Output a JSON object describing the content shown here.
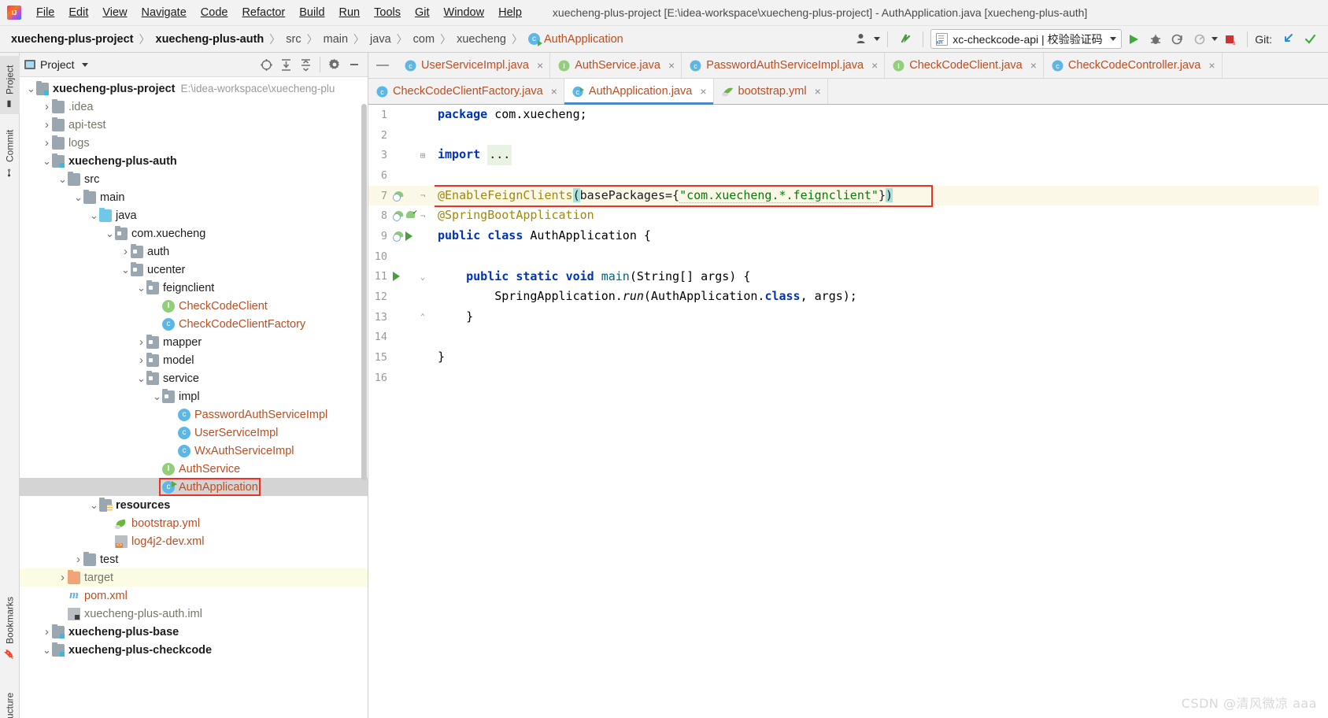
{
  "window": {
    "title": "xuecheng-plus-project [E:\\idea-workspace\\xuecheng-plus-project] - AuthApplication.java [xuecheng-plus-auth]"
  },
  "menu": {
    "items": [
      {
        "label": "File"
      },
      {
        "label": "Edit"
      },
      {
        "label": "View"
      },
      {
        "label": "Navigate"
      },
      {
        "label": "Code"
      },
      {
        "label": "Refactor"
      },
      {
        "label": "Build"
      },
      {
        "label": "Run"
      },
      {
        "label": "Tools"
      },
      {
        "label": "Git"
      },
      {
        "label": "Window"
      },
      {
        "label": "Help"
      }
    ]
  },
  "breadcrumb": {
    "items": [
      {
        "label": "xuecheng-plus-project",
        "style": "bold"
      },
      {
        "label": "xuecheng-plus-auth",
        "style": "bold"
      },
      {
        "label": "src",
        "style": "normal"
      },
      {
        "label": "main",
        "style": "normal"
      },
      {
        "label": "java",
        "style": "normal"
      },
      {
        "label": "com",
        "style": "normal"
      },
      {
        "label": "xuecheng",
        "style": "normal"
      },
      {
        "label": "AuthApplication",
        "style": "class"
      }
    ],
    "separator": "〉"
  },
  "toolbar": {
    "run_config": "xc-checkcode-api | 校验验证码",
    "git_label": "Git:",
    "icons": [
      "user-settings-icon",
      "search-everywhere-icon",
      "run-icon",
      "debug-icon",
      "run-with-coverage-icon",
      "profiler-icon",
      "stop-icon",
      "update-project-icon",
      "commit-icon"
    ]
  },
  "left_strip": {
    "tabs": [
      {
        "label": "Project",
        "icon": "project-icon",
        "selected": true
      },
      {
        "label": "Commit",
        "icon": "commit-icon",
        "selected": false
      },
      {
        "label": "Bookmarks",
        "icon": "bookmark-icon",
        "selected": false
      },
      {
        "label": "ucture",
        "icon": "structure-icon",
        "selected": false
      }
    ]
  },
  "project_panel": {
    "title": "Project",
    "tools": [
      "locate-icon",
      "expand-all-icon",
      "collapse-all-icon",
      "settings-icon",
      "hide-icon"
    ],
    "tree": [
      {
        "depth": 0,
        "arrow": "v",
        "icon": "module",
        "label": "xuecheng-plus-project",
        "style": "bold",
        "hint": "E:\\idea-workspace\\xuecheng-plu"
      },
      {
        "depth": 1,
        "arrow": ">",
        "icon": "folder",
        "label": ".idea",
        "style": "gray",
        "hint": ""
      },
      {
        "depth": 1,
        "arrow": ">",
        "icon": "folder",
        "label": "api-test",
        "style": "gray",
        "hint": ""
      },
      {
        "depth": 1,
        "arrow": ">",
        "icon": "folder",
        "label": "logs",
        "style": "gray",
        "hint": ""
      },
      {
        "depth": 1,
        "arrow": "v",
        "icon": "module",
        "label": "xuecheng-plus-auth",
        "style": "bold",
        "hint": ""
      },
      {
        "depth": 2,
        "arrow": "v",
        "icon": "folder",
        "label": "src",
        "style": "normal",
        "hint": ""
      },
      {
        "depth": 3,
        "arrow": "v",
        "icon": "folder",
        "label": "main",
        "style": "normal",
        "hint": ""
      },
      {
        "depth": 4,
        "arrow": "v",
        "icon": "folder-blue",
        "label": "java",
        "style": "normal",
        "hint": ""
      },
      {
        "depth": 5,
        "arrow": "v",
        "icon": "pkg",
        "label": "com.xuecheng",
        "style": "normal",
        "hint": ""
      },
      {
        "depth": 6,
        "arrow": ">",
        "icon": "pkg",
        "label": "auth",
        "style": "normal",
        "hint": ""
      },
      {
        "depth": 6,
        "arrow": "v",
        "icon": "pkg",
        "label": "ucenter",
        "style": "normal",
        "hint": ""
      },
      {
        "depth": 7,
        "arrow": "v",
        "icon": "pkg",
        "label": "feignclient",
        "style": "normal",
        "hint": ""
      },
      {
        "depth": 8,
        "arrow": "",
        "icon": "iface",
        "label": "CheckCodeClient",
        "style": "orange",
        "hint": ""
      },
      {
        "depth": 8,
        "arrow": "",
        "icon": "class",
        "label": "CheckCodeClientFactory",
        "style": "orange",
        "hint": ""
      },
      {
        "depth": 7,
        "arrow": ">",
        "icon": "pkg",
        "label": "mapper",
        "style": "normal",
        "hint": ""
      },
      {
        "depth": 7,
        "arrow": ">",
        "icon": "pkg",
        "label": "model",
        "style": "normal",
        "hint": ""
      },
      {
        "depth": 7,
        "arrow": "v",
        "icon": "pkg",
        "label": "service",
        "style": "normal",
        "hint": ""
      },
      {
        "depth": 8,
        "arrow": "v",
        "icon": "pkg",
        "label": "impl",
        "style": "normal",
        "hint": ""
      },
      {
        "depth": 9,
        "arrow": "",
        "icon": "class",
        "label": "PasswordAuthServiceImpl",
        "style": "orange",
        "hint": ""
      },
      {
        "depth": 9,
        "arrow": "",
        "icon": "class",
        "label": "UserServiceImpl",
        "style": "orange",
        "hint": ""
      },
      {
        "depth": 9,
        "arrow": "",
        "icon": "class",
        "label": "WxAuthServiceImpl",
        "style": "orange",
        "hint": ""
      },
      {
        "depth": 8,
        "arrow": "",
        "icon": "iface",
        "label": "AuthService",
        "style": "orange",
        "hint": ""
      },
      {
        "depth": 8,
        "arrow": "",
        "icon": "springclass",
        "label": "AuthApplication",
        "style": "orange",
        "hint": "",
        "selected": true,
        "boxed": true
      },
      {
        "depth": 4,
        "arrow": "v",
        "icon": "res",
        "label": "resources",
        "style": "bold",
        "hint": ""
      },
      {
        "depth": 5,
        "arrow": "",
        "icon": "yml",
        "label": "bootstrap.yml",
        "style": "orange",
        "hint": ""
      },
      {
        "depth": 5,
        "arrow": "",
        "icon": "xml",
        "label": "log4j2-dev.xml",
        "style": "orange",
        "hint": ""
      },
      {
        "depth": 3,
        "arrow": ">",
        "icon": "folder",
        "label": "test",
        "style": "normal",
        "hint": ""
      },
      {
        "depth": 2,
        "arrow": ">",
        "icon": "folder-orange",
        "label": "target",
        "style": "gray",
        "hint": "",
        "highlight": true
      },
      {
        "depth": 2,
        "arrow": "",
        "icon": "mvn",
        "label": "pom.xml",
        "style": "orange",
        "hint": ""
      },
      {
        "depth": 2,
        "arrow": "",
        "icon": "iml",
        "label": "xuecheng-plus-auth.iml",
        "style": "gray",
        "hint": ""
      },
      {
        "depth": 1,
        "arrow": ">",
        "icon": "module",
        "label": "xuecheng-plus-base",
        "style": "bold",
        "hint": ""
      },
      {
        "depth": 1,
        "arrow": "v",
        "icon": "module",
        "label": "xuecheng-plus-checkcode",
        "style": "bold",
        "hint": ""
      }
    ]
  },
  "editor": {
    "tabs_row1": [
      {
        "label": "UserServiceImpl.java",
        "icon": "class",
        "active": false
      },
      {
        "label": "AuthService.java",
        "icon": "iface",
        "active": false
      },
      {
        "label": "PasswordAuthServiceImpl.java",
        "icon": "class",
        "active": false
      },
      {
        "label": "CheckCodeClient.java",
        "icon": "iface",
        "active": false
      },
      {
        "label": "CheckCodeController.java",
        "icon": "class",
        "active": false
      }
    ],
    "tabs_row2": [
      {
        "label": "CheckCodeClientFactory.java",
        "icon": "class",
        "active": false
      },
      {
        "label": "AuthApplication.java",
        "icon": "springclass",
        "active": true
      },
      {
        "label": "bootstrap.yml",
        "icon": "yml",
        "active": false
      }
    ],
    "close_glyph": "×",
    "lines": [
      {
        "num": "1",
        "gutter": [],
        "text": "package com.xuecheng;"
      },
      {
        "num": "2",
        "gutter": [],
        "text": ""
      },
      {
        "num": "3",
        "gutter": [],
        "text": "import ...",
        "fold": true
      },
      {
        "num": "6",
        "gutter": [],
        "text": ""
      },
      {
        "num": "7",
        "gutter": [
          "bean"
        ],
        "text": "@EnableFeignClients(basePackages={\"com.xuecheng.*.feignclient\"})",
        "highlight": true,
        "boxed": true
      },
      {
        "num": "8",
        "gutter": [
          "bean",
          "cert"
        ],
        "text": "@SpringBootApplication"
      },
      {
        "num": "9",
        "gutter": [
          "springbean",
          "run"
        ],
        "text": "public class AuthApplication {"
      },
      {
        "num": "10",
        "gutter": [],
        "text": ""
      },
      {
        "num": "11",
        "gutter": [
          "run"
        ],
        "text": "    public static void main(String[] args) {"
      },
      {
        "num": "12",
        "gutter": [],
        "text": "        SpringApplication.run(AuthApplication.class, args);"
      },
      {
        "num": "13",
        "gutter": [],
        "text": "    }"
      },
      {
        "num": "14",
        "gutter": [],
        "text": ""
      },
      {
        "num": "15",
        "gutter": [],
        "text": "}"
      },
      {
        "num": "16",
        "gutter": [],
        "text": ""
      }
    ]
  },
  "watermark": "CSDN @清风微凉 aaa",
  "colors": {
    "accent_blue": "#4a88c7",
    "highlight_box": "#ee3124",
    "keyword": "#0033b3",
    "annotation": "#9e880d",
    "string": "#047d06",
    "tab_text": "#bb4e22",
    "line_highlight": "#fbf8e8"
  }
}
